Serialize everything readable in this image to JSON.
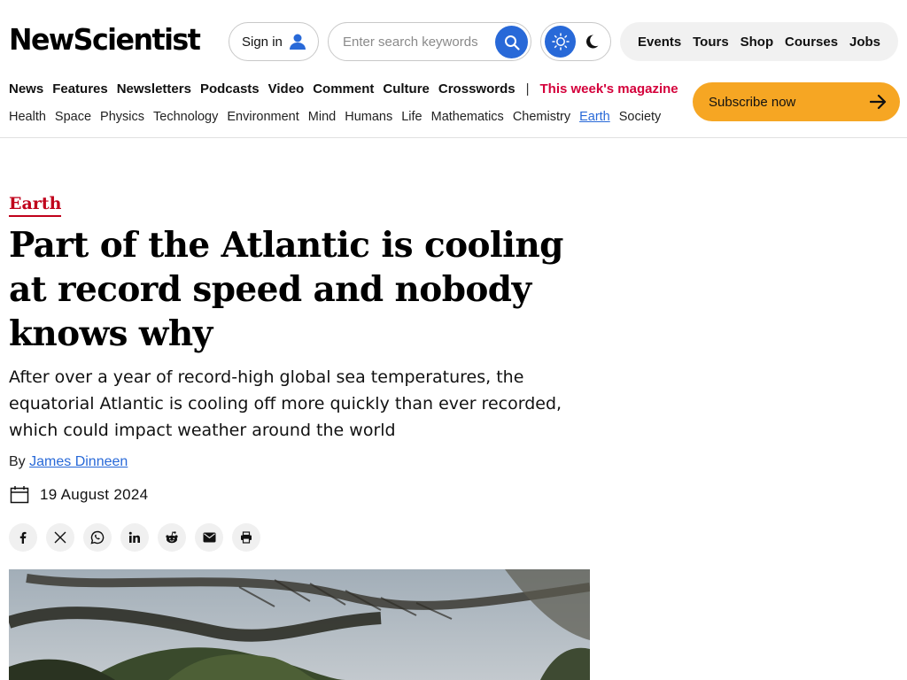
{
  "header": {
    "logo_text": "NewScientist",
    "sign_in_label": "Sign in",
    "search_placeholder": "Enter search keywords",
    "utility_links": [
      "Events",
      "Tours",
      "Shop",
      "Courses",
      "Jobs"
    ]
  },
  "primary_nav": {
    "items": [
      "News",
      "Features",
      "Newsletters",
      "Podcasts",
      "Video",
      "Comment",
      "Culture",
      "Crosswords"
    ],
    "separator": "|",
    "magazine_link": "This week's magazine"
  },
  "secondary_nav": {
    "items": [
      "Health",
      "Space",
      "Physics",
      "Technology",
      "Environment",
      "Mind",
      "Humans",
      "Life",
      "Mathematics",
      "Chemistry",
      "Earth",
      "Society"
    ],
    "active": "Earth"
  },
  "subscribe_label": "Subscribe now",
  "article": {
    "section": "Earth",
    "headline": "Part of the Atlantic is cooling at record speed and nobody knows why",
    "standfirst": "After over a year of record-high global sea temperatures, the equatorial Atlantic is cooling off more quickly than ever recorded, which could impact weather around the world",
    "byline_prefix": "By",
    "author": "James Dinneen",
    "date": "19 August 2024"
  },
  "share_icons": [
    "facebook-icon",
    "x-icon",
    "whatsapp-icon",
    "linkedin-icon",
    "reddit-icon",
    "email-icon",
    "print-icon"
  ],
  "colors": {
    "accent_blue": "#2869d8",
    "magazine_red": "#d4003b",
    "section_red": "#c0001b",
    "subscribe_orange": "#f6a623"
  }
}
